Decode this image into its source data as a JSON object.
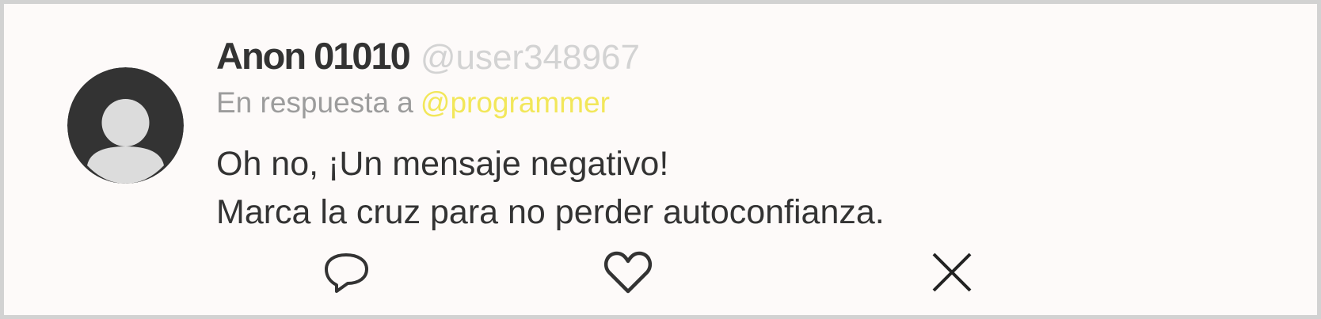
{
  "tweet": {
    "author_name": "Anon 01010",
    "author_handle": "@user348967",
    "reply_prefix": "En respuesta a",
    "reply_to": "@programmer",
    "text_lines": [
      "Oh no, ¡Un mensaje negativo!",
      "Marca la cruz para no perder autoconfianza."
    ]
  },
  "actions": {
    "reply_icon": "speech-bubble-icon",
    "like_icon": "heart-icon",
    "close_icon": "x-close-icon"
  },
  "colors": {
    "background": "#fdfaf9",
    "border": "#d2d2d2",
    "text": "#333333",
    "handle": "#d3d3d3",
    "reply_prefix": "#9c9c9c",
    "mention": "#f2e75a",
    "avatar_bg": "#333333",
    "avatar_silhouette": "#dcdcdc"
  }
}
